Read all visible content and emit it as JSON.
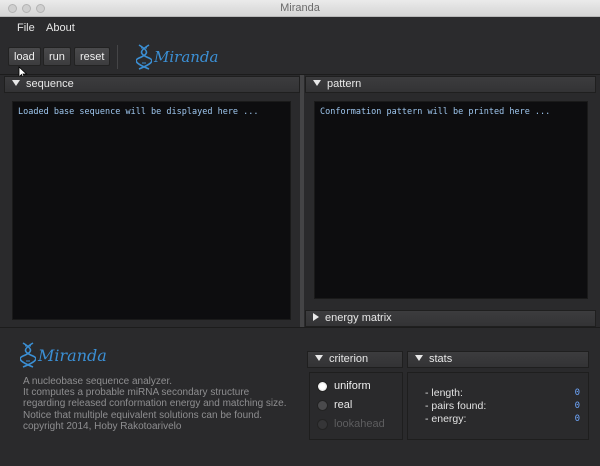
{
  "window": {
    "title": "Miranda"
  },
  "menu": {
    "file": "File",
    "about": "About"
  },
  "toolbar": {
    "load_label": "load",
    "run_label": "run",
    "reset_label": "reset"
  },
  "logo": {
    "text": "Miranda"
  },
  "sequence": {
    "header": "sequence",
    "placeholder": "Loaded base sequence will be displayed here ..."
  },
  "pattern": {
    "header": "pattern",
    "placeholder": "Conformation pattern will be printed here ..."
  },
  "energy_matrix": {
    "header": "energy matrix"
  },
  "about": {
    "lines": [
      "A nucleobase sequence analyzer.",
      "It computes a probable miRNA secondary structure",
      "regarding released conformation energy and matching size.",
      "Notice that multiple equivalent solutions can be found.",
      "copyright 2014, Hoby Rakotoarivelo"
    ]
  },
  "criterion": {
    "header": "criterion",
    "options": [
      {
        "label": "uniform",
        "state": "selected"
      },
      {
        "label": "real",
        "state": "unselected"
      },
      {
        "label": "lookahead",
        "state": "disabled"
      }
    ]
  },
  "stats": {
    "header": "stats",
    "rows": [
      {
        "label": "- length:",
        "value": "0"
      },
      {
        "label": "- pairs found:",
        "value": "0"
      },
      {
        "label": "- energy:",
        "value": "0"
      }
    ]
  },
  "colors": {
    "accent": "#3b8fd4",
    "text_blue": "#9ec6ee",
    "value_blue": "#6fa8ff"
  }
}
